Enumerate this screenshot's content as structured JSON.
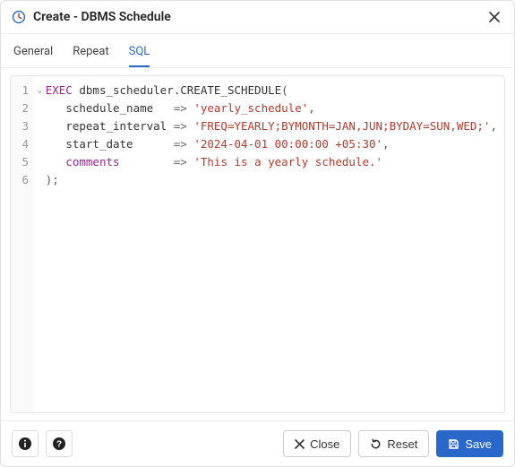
{
  "titlebar": {
    "title": "Create - DBMS Schedule"
  },
  "tabs": [
    {
      "label": "General",
      "active": false
    },
    {
      "label": "Repeat",
      "active": false
    },
    {
      "label": "SQL",
      "active": true
    }
  ],
  "editor": {
    "lines": [
      "1",
      "2",
      "3",
      "4",
      "5",
      "6"
    ],
    "fold_on_line": 1,
    "code": {
      "exec_kw": "EXEC",
      "call": "dbms_scheduler.CREATE_SCHEDULE",
      "open": "(",
      "params": [
        {
          "name": "schedule_name",
          "value": "'yearly_schedule'",
          "trail": ","
        },
        {
          "name": "repeat_interval",
          "value": "'FREQ=YEARLY;BYMONTH=JAN,JUN;BYDAY=SUN,WED;'",
          "trail": ","
        },
        {
          "name": "start_date",
          "value": "'2024-04-01 00:00:00 +05:30'",
          "trail": ","
        },
        {
          "name": "comments",
          "value": "'This is a yearly schedule.'",
          "trail": "",
          "kw": true
        }
      ],
      "close": ");",
      "arrow": "=>"
    }
  },
  "footer": {
    "close": "Close",
    "reset": "Reset",
    "save": "Save"
  }
}
